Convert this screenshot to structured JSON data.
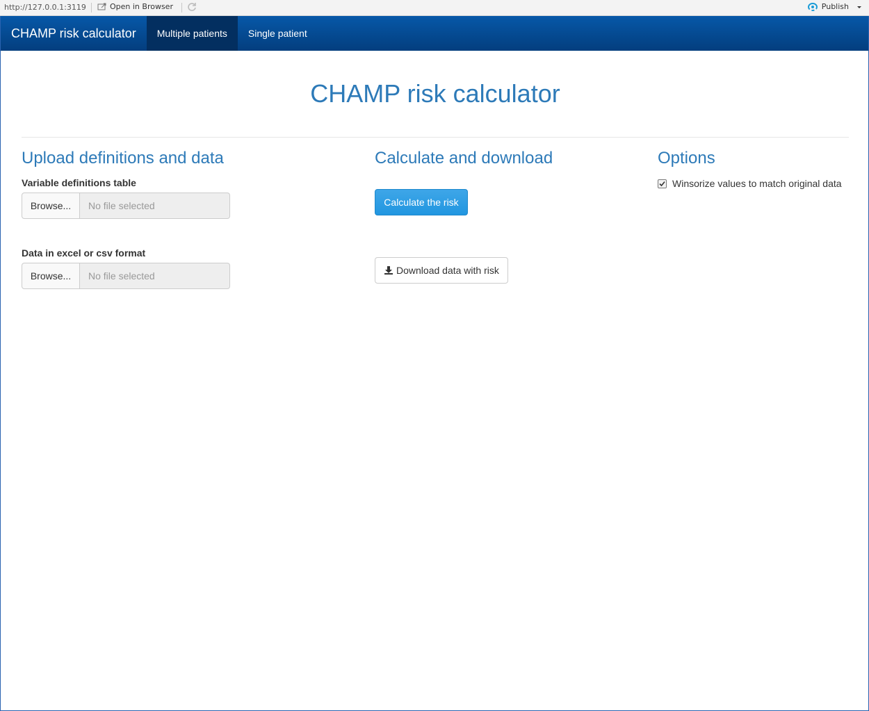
{
  "viewer": {
    "url": "http://127.0.0.1:3119",
    "open_in_browser": "Open in Browser",
    "publish": "Publish"
  },
  "navbar": {
    "brand": "CHAMP risk calculator",
    "tabs": [
      {
        "label": "Multiple patients",
        "active": true
      },
      {
        "label": "Single patient",
        "active": false
      }
    ]
  },
  "page": {
    "title": "CHAMP risk calculator"
  },
  "upload": {
    "heading": "Upload definitions and data",
    "definitions_label": "Variable definitions table",
    "data_label": "Data in excel or csv format",
    "browse_label": "Browse...",
    "no_file": "No file selected"
  },
  "calculate": {
    "heading": "Calculate and download",
    "calculate_button": "Calculate the risk",
    "download_button": "Download data with risk"
  },
  "options": {
    "heading": "Options",
    "winsorize_label": "Winsorize values to match original data",
    "winsorize_checked": true
  },
  "colors": {
    "navbar": "#033e7e",
    "accent": "#2d7ab8",
    "primary_button": "#2196e0"
  }
}
